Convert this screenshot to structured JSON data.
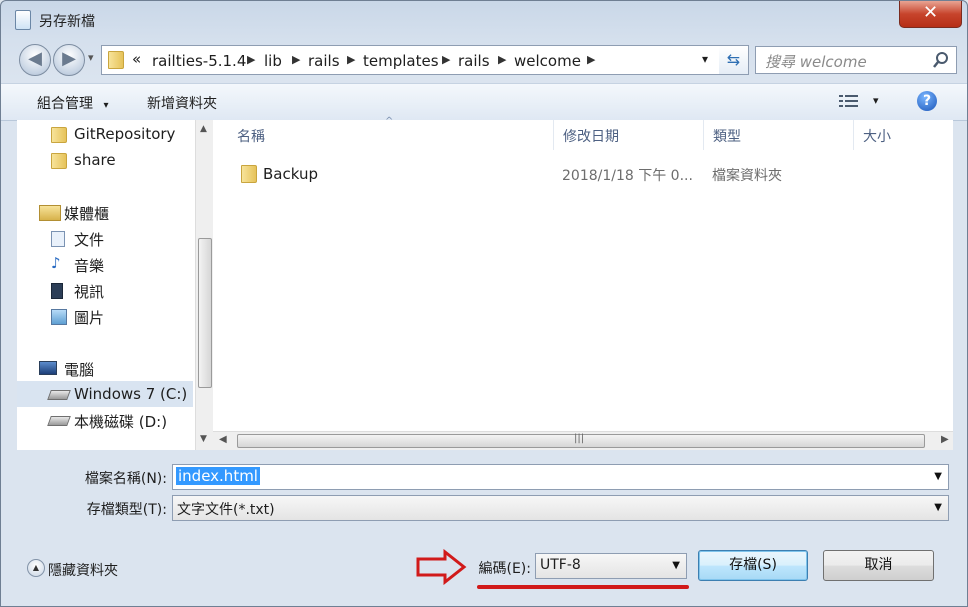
{
  "window": {
    "title": "另存新檔",
    "close_glyph": "✕"
  },
  "nav": {
    "back_glyph": "◀",
    "forward_glyph": "▶",
    "dropdown_glyph": "▾"
  },
  "address": {
    "overflow": "«",
    "crumbs": [
      "railties-5.1.4",
      "lib",
      "rails",
      "templates",
      "rails",
      "welcome"
    ],
    "sep_glyph": "▶",
    "dropdown_glyph": "▾",
    "refresh_glyph": "⇆"
  },
  "search": {
    "placeholder": "搜尋 welcome",
    "icon": "search-icon"
  },
  "toolbar": {
    "organize_label": "組合管理",
    "organize_glyph": "▾",
    "new_folder_label": "新增資料夾",
    "views_glyph": "▾",
    "help_glyph": "?"
  },
  "sidebar": {
    "items": [
      {
        "label": "GitRepository",
        "icon": "folder-icon"
      },
      {
        "label": "share",
        "icon": "folder-icon"
      },
      {
        "label": "媒體櫃",
        "icon": "library-icon"
      },
      {
        "label": "文件",
        "icon": "documents-icon"
      },
      {
        "label": "音樂",
        "icon": "music-icon"
      },
      {
        "label": "視訊",
        "icon": "video-icon"
      },
      {
        "label": "圖片",
        "icon": "pictures-icon"
      },
      {
        "label": "電腦",
        "icon": "computer-icon"
      },
      {
        "label": "Windows 7 (C:)",
        "icon": "drive-icon"
      },
      {
        "label": "本機磁碟 (D:)",
        "icon": "drive-icon"
      }
    ],
    "selected": "Windows 7 (C:)"
  },
  "files": {
    "columns": [
      "名稱",
      "修改日期",
      "類型",
      "大小"
    ],
    "rows": [
      {
        "name": "Backup",
        "modified": "2018/1/18 下午 0...",
        "type": "檔案資料夾",
        "size": ""
      }
    ]
  },
  "form": {
    "filename_label": "檔案名稱(N):",
    "filename_value": "index.html",
    "filetype_label": "存檔類型(T):",
    "filetype_value": "文字文件(*.txt)",
    "encoding_label": "編碼(E):",
    "encoding_value": "UTF-8"
  },
  "footer": {
    "hide_folders_label": "隱藏資料夾",
    "hide_glyph": "▲",
    "save_label": "存檔(S)",
    "cancel_label": "取消"
  },
  "colors": {
    "accent": "#3399ff",
    "annotation": "#d11a1a",
    "selection": "#3399ff"
  }
}
